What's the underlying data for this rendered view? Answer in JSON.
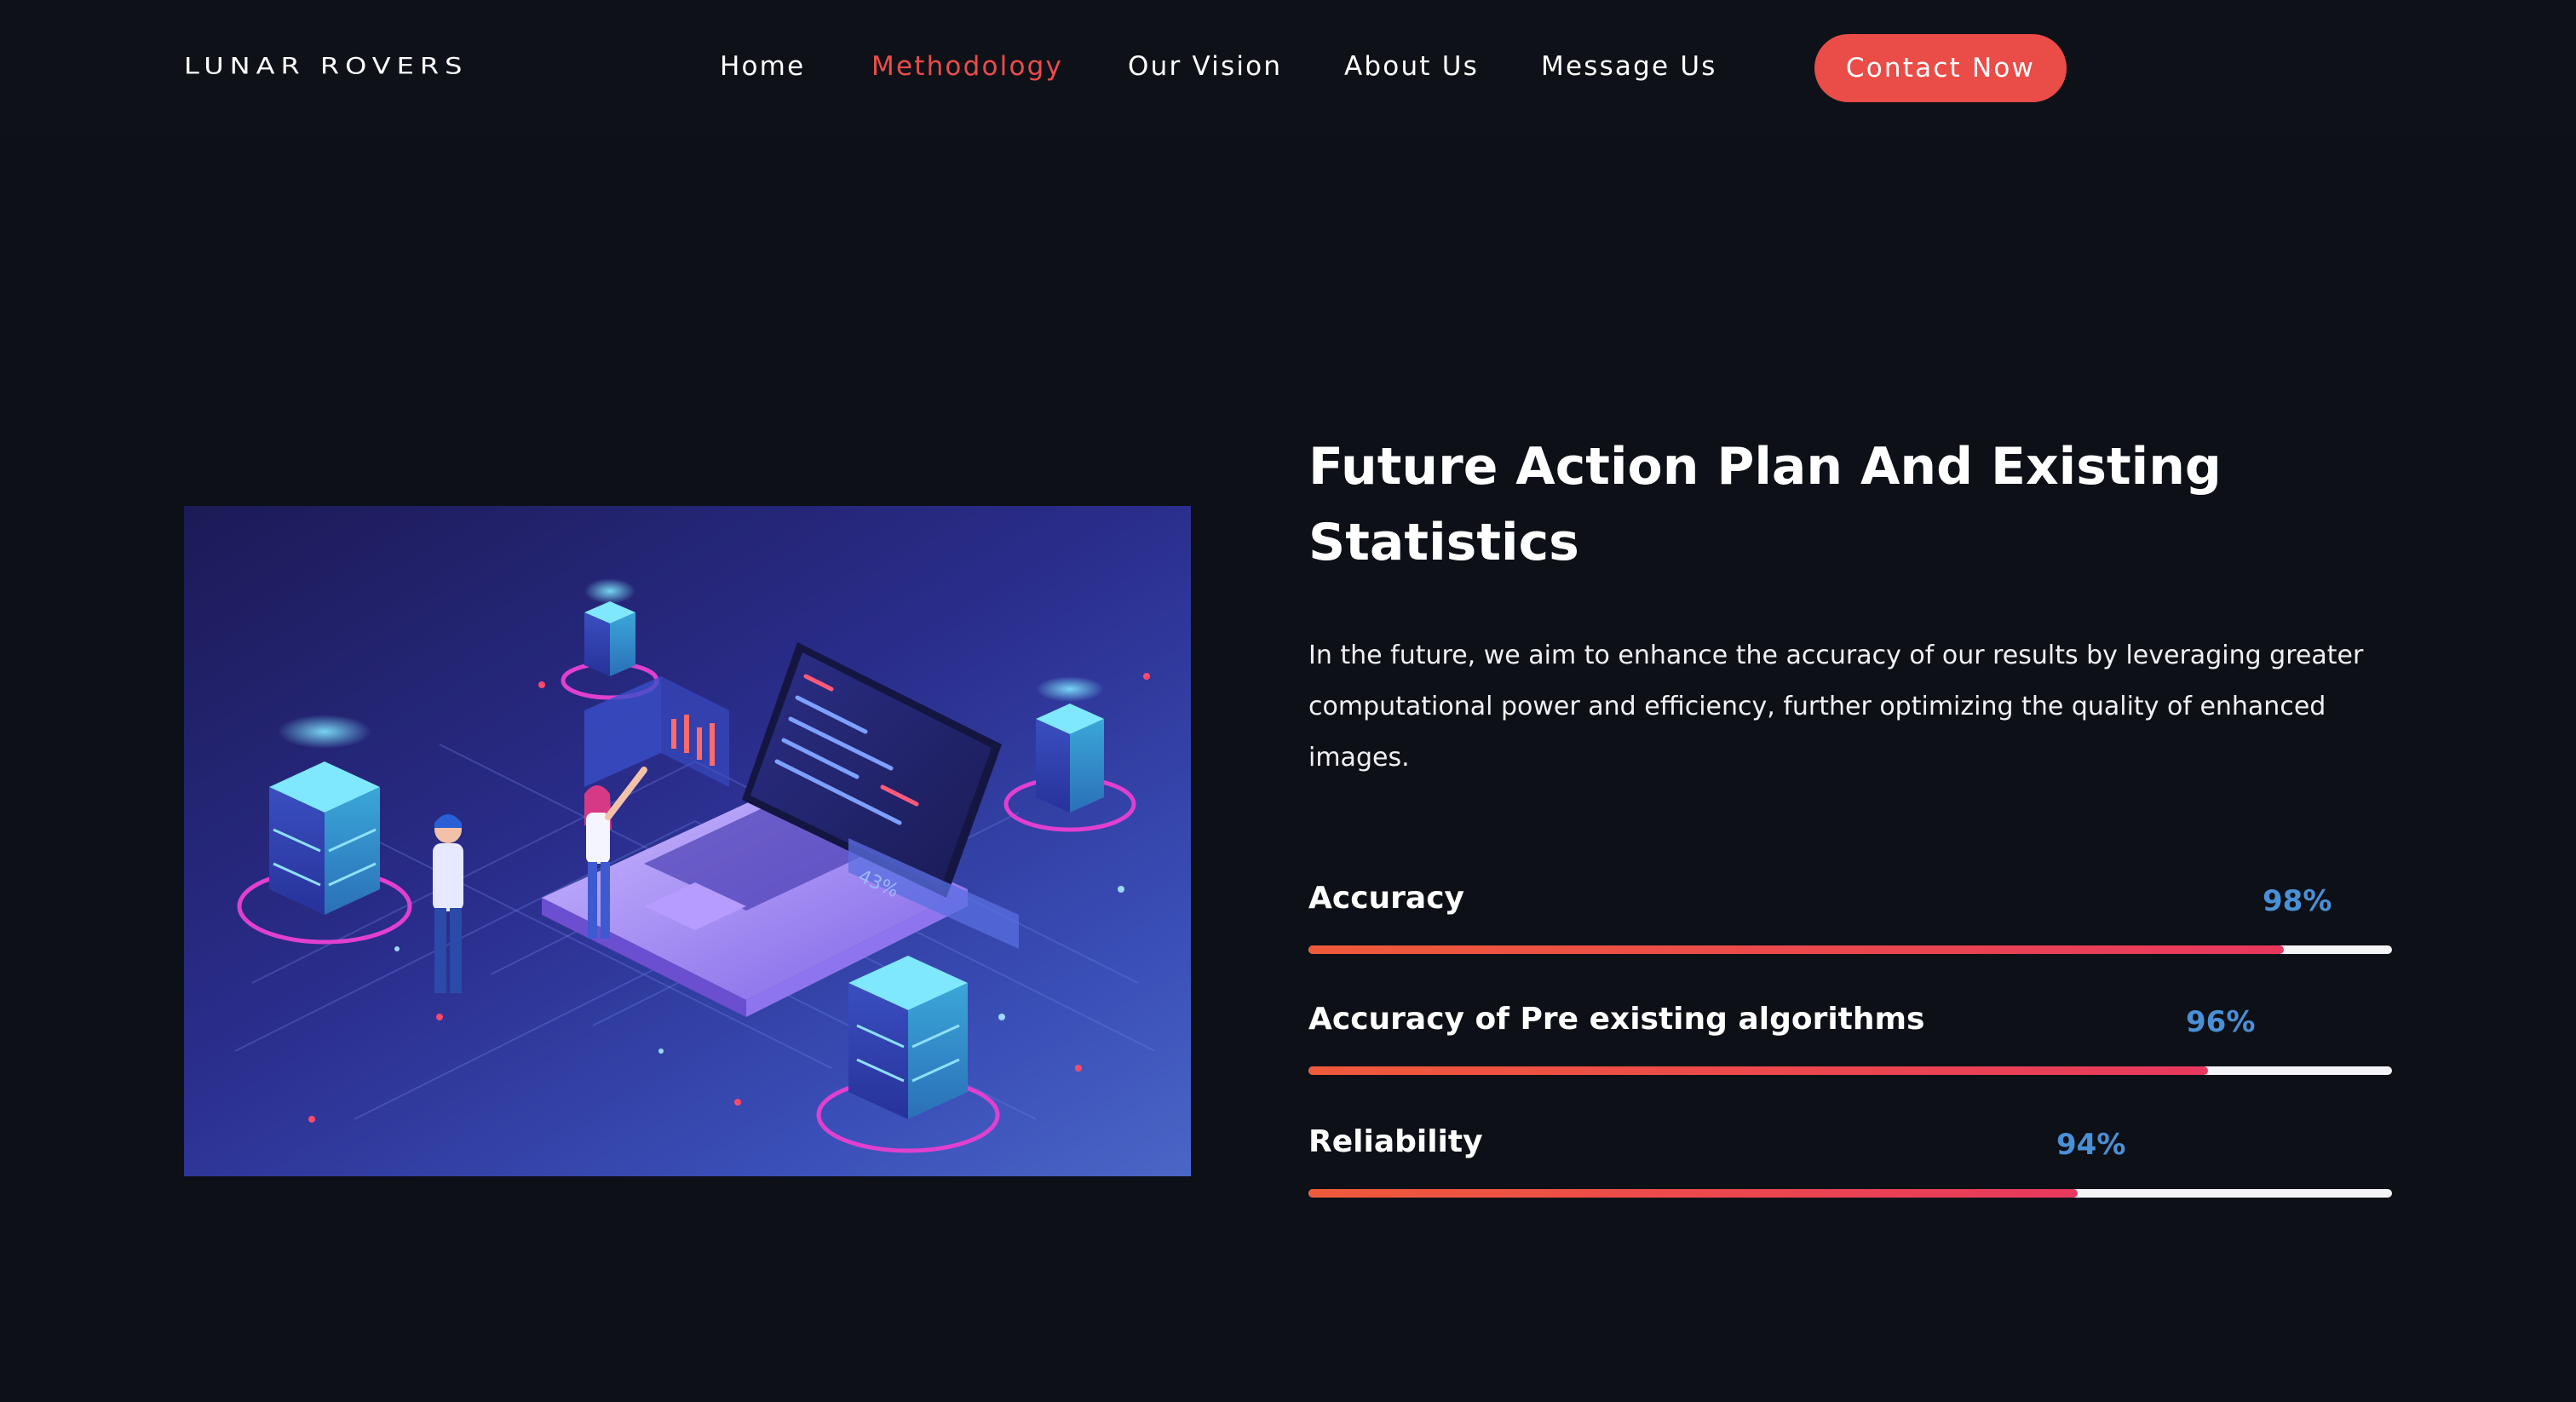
{
  "header": {
    "logo": "LUNAR ROVERS",
    "nav": [
      {
        "label": "Home",
        "active": false
      },
      {
        "label": "Methodology",
        "active": true
      },
      {
        "label": "Our Vision",
        "active": false
      },
      {
        "label": "About Us",
        "active": false
      },
      {
        "label": "Message Us",
        "active": false
      }
    ],
    "cta_label": "Contact Now"
  },
  "main": {
    "title_line1": "Future Action Plan And Existing",
    "title_line2": "Statistics",
    "description": "In the future, we aim to enhance the accuracy of our results by leveraging greater computational power and efficiency, further optimizing the quality of enhanced images.",
    "illustration_badge": "43%",
    "stats": [
      {
        "label": "Accuracy",
        "value_text": "98%",
        "fill_fraction": 0.9
      },
      {
        "label": "Accuracy of Pre existing algorithms",
        "value_text": "96%",
        "fill_fraction": 0.83
      },
      {
        "label": "Reliability",
        "value_text": "94%",
        "fill_fraction": 0.71
      }
    ]
  },
  "colors": {
    "background": "#0d1017",
    "accent": "#ea4c48",
    "active_nav": "#ec4c4a",
    "percent_text": "#4a90d6",
    "bar_start": "#ef5a3a",
    "bar_end": "#e8385e",
    "track": "#f4f4f6"
  }
}
